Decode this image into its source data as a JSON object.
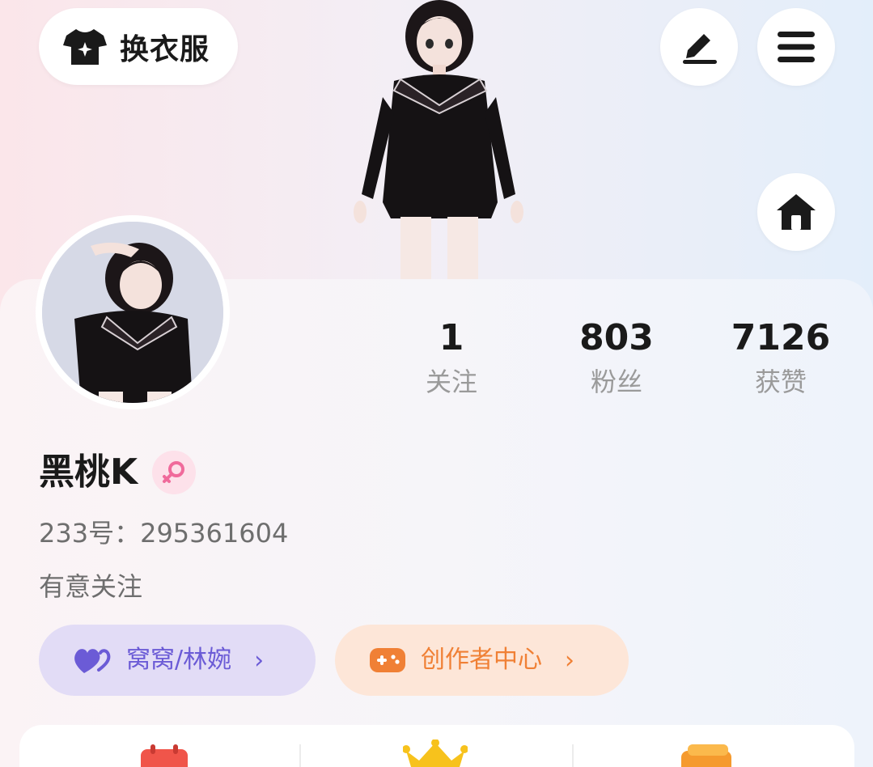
{
  "header": {
    "outfit_label": "换衣服",
    "icons": {
      "outfit": "shirt-icon",
      "edit": "pen-icon",
      "menu": "menu-icon",
      "home": "home-icon"
    }
  },
  "stats": [
    {
      "value": "1",
      "label": "关注"
    },
    {
      "value": "803",
      "label": "粉丝"
    },
    {
      "value": "7126",
      "label": "获赞"
    }
  ],
  "profile": {
    "name": "黑桃K",
    "gender_icon": "female-icon",
    "uid": "233号：295361604",
    "bio": "有意关注"
  },
  "pills": {
    "relation": {
      "label": "窝窝/林婉",
      "icon": "hearts-icon"
    },
    "creator": {
      "label": "创作者中心",
      "icon": "gamepad-icon"
    }
  },
  "features": {
    "icons": [
      "calendar-icon",
      "crown-icon",
      "card-icon"
    ]
  },
  "colors": {
    "relation_accent": "#6b5bd6",
    "creator_accent": "#f08035",
    "gender_accent": "#f06a9b"
  }
}
